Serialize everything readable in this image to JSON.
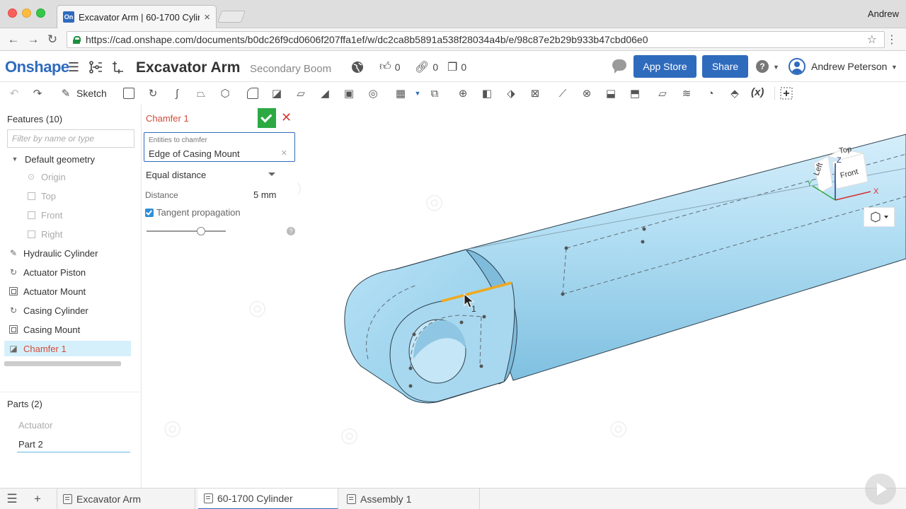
{
  "browser": {
    "tab_title": "Excavator Arm | 60-1700 Cylinder",
    "tab_favicon": "On",
    "profile_name": "Andrew",
    "url": "https://cad.onshape.com/documents/b0dc26f9cd0606f207ffa1ef/w/dc2ca8b5891a538f28034a4b/e/98c87e2b29b933b47cbd06e0"
  },
  "header": {
    "logo": "Onshape",
    "doc_title": "Excavator Arm",
    "doc_subtitle": "Secondary Boom",
    "likes": "0",
    "links": "0",
    "copies": "0",
    "app_store_label": "App Store",
    "share_label": "Share",
    "user_name": "Andrew Peterson"
  },
  "toolbar": {
    "sketch_label": "Sketch",
    "variable_label": "(x)"
  },
  "features": {
    "heading": "Features (10)",
    "filter_placeholder": "Filter by name or type",
    "default_geometry": "Default geometry",
    "planes": [
      "Origin",
      "Top",
      "Front",
      "Right"
    ],
    "items": [
      {
        "label": "Hydraulic Cylinder",
        "icon": "sketch-icon"
      },
      {
        "label": "Actuator Piston",
        "icon": "revolve-icon"
      },
      {
        "label": "Actuator Mount",
        "icon": "extrude-icon"
      },
      {
        "label": "Casing Cylinder",
        "icon": "revolve-icon"
      },
      {
        "label": "Casing Mount",
        "icon": "extrude-icon"
      },
      {
        "label": "Chamfer 1",
        "icon": "chamfer-icon"
      }
    ]
  },
  "parts": {
    "heading": "Parts (2)",
    "items": [
      "Actuator",
      "Part 2"
    ]
  },
  "dialog": {
    "title": "Chamfer 1",
    "entities_label": "Entities to chamfer",
    "entity_value": "Edge of Casing Mount",
    "type_value": "Equal distance",
    "distance_label": "Distance",
    "distance_value": "5 mm",
    "tangent_label": "Tangent propagation",
    "tangent_checked": true
  },
  "viewport": {
    "cursor_label": "1",
    "cube": {
      "top": "Top",
      "left": "Left",
      "front": "Front",
      "x": "X",
      "y": "Y",
      "z": "Z"
    },
    "highlight_color": "#f0a81e",
    "body_color": "#a9d8ef"
  },
  "bottom_tabs": [
    {
      "label": "Excavator Arm",
      "active": false
    },
    {
      "label": "60-1700 Cylinder",
      "active": true
    },
    {
      "label": "Assembly 1",
      "active": false
    }
  ],
  "colors": {
    "brand": "#2f6bbd",
    "feature_active": "#d24a3a",
    "ok": "#2ca943"
  }
}
